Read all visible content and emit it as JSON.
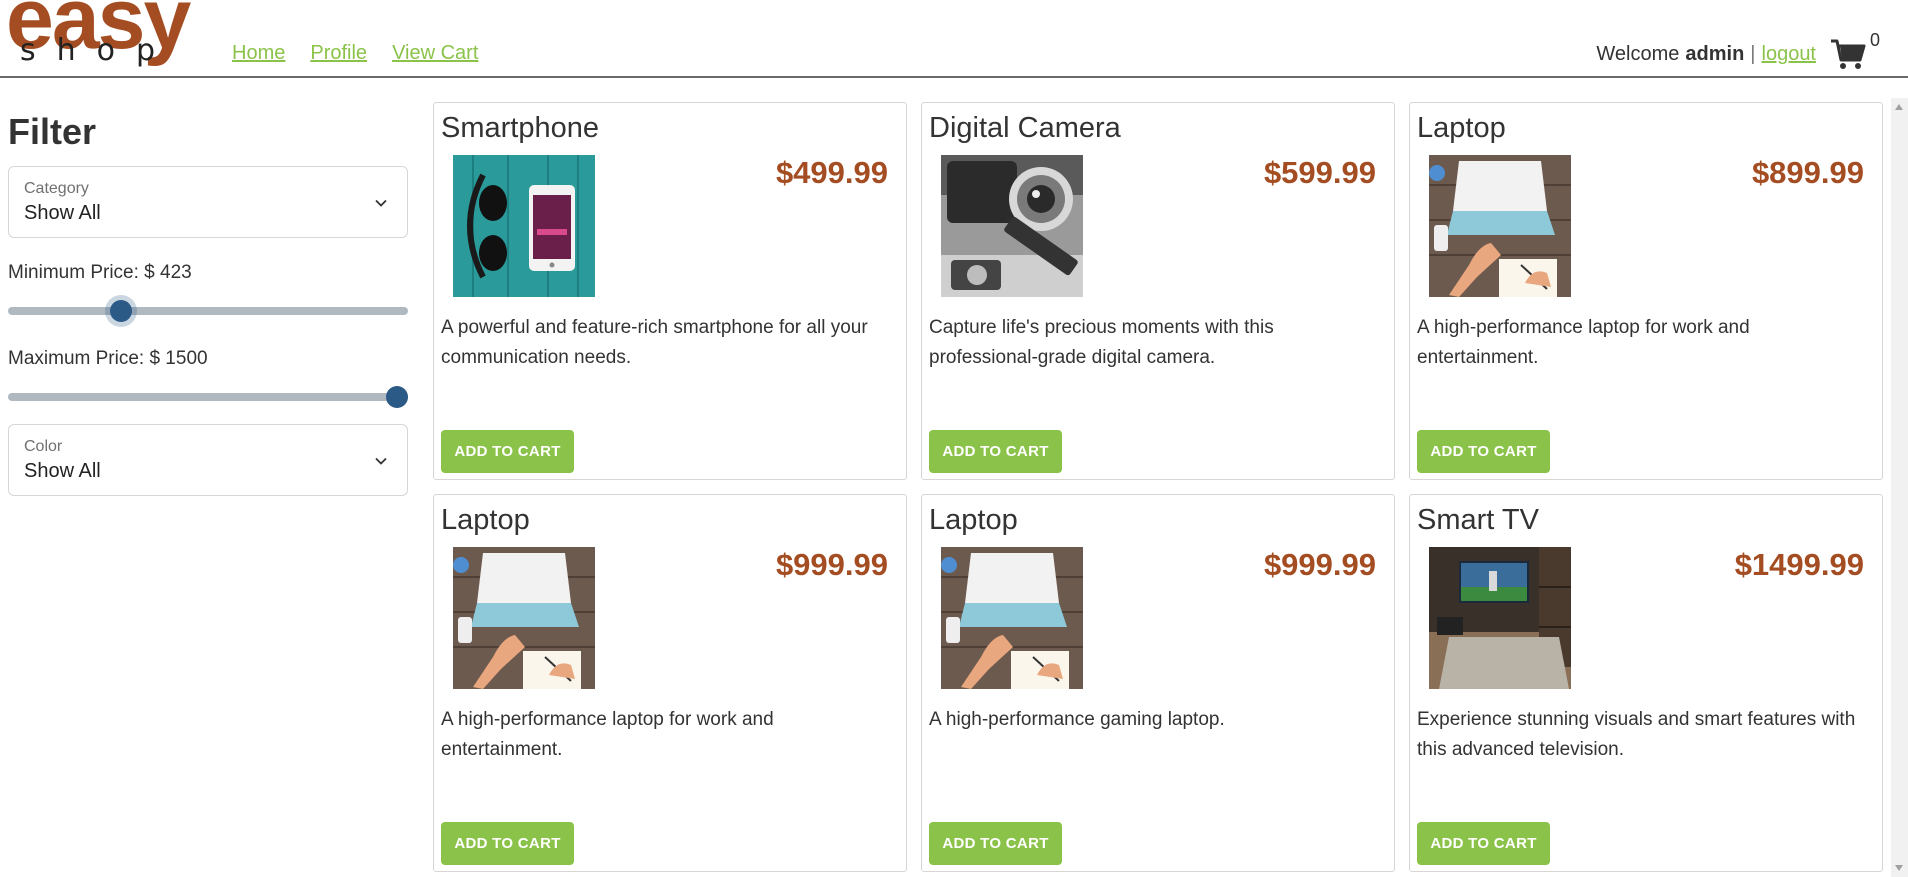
{
  "logo": {
    "main": "easy",
    "sub": "shop"
  },
  "nav": {
    "home": "Home",
    "profile": "Profile",
    "view_cart": "View Cart"
  },
  "user": {
    "welcome": "Welcome",
    "name": "admin",
    "separator": "|",
    "logout": "logout",
    "cart_count": "0"
  },
  "filter": {
    "title": "Filter",
    "category": {
      "label": "Category",
      "value": "Show All"
    },
    "min_price": {
      "label": "Minimum Price: $ 423",
      "value": 423
    },
    "max_price": {
      "label": "Maximum Price: $ 1500",
      "value": 1500
    },
    "color": {
      "label": "Color",
      "value": "Show All"
    }
  },
  "products": [
    {
      "name": "Smartphone",
      "price": "$499.99",
      "description": "A powerful and feature-rich smartphone for all your communication needs.",
      "image": "smartphone-headphones-image",
      "button": "ADD TO CART"
    },
    {
      "name": "Digital Camera",
      "price": "$599.99",
      "description": "Capture life's precious moments with this professional-grade digital camera.",
      "image": "camera-image",
      "button": "ADD TO CART"
    },
    {
      "name": "Laptop",
      "price": "$899.99",
      "description": "A high-performance laptop for work and entertainment.",
      "image": "laptop-desk-image",
      "button": "ADD TO CART"
    },
    {
      "name": "Laptop",
      "price": "$999.99",
      "description": "A high-performance laptop for work and entertainment.",
      "image": "laptop-desk-image",
      "button": "ADD TO CART"
    },
    {
      "name": "Laptop",
      "price": "$999.99",
      "description": "A high-performance gaming laptop.",
      "image": "laptop-desk-image",
      "button": "ADD TO CART"
    },
    {
      "name": "Smart TV",
      "price": "$1499.99",
      "description": "Experience stunning visuals and smart features with this advanced television.",
      "image": "smart-tv-room-image",
      "button": "ADD TO CART"
    }
  ],
  "colors": {
    "accent_green": "#8bc34a",
    "brand_rust": "#a44d22",
    "slider_thumb": "#2c5a86"
  }
}
